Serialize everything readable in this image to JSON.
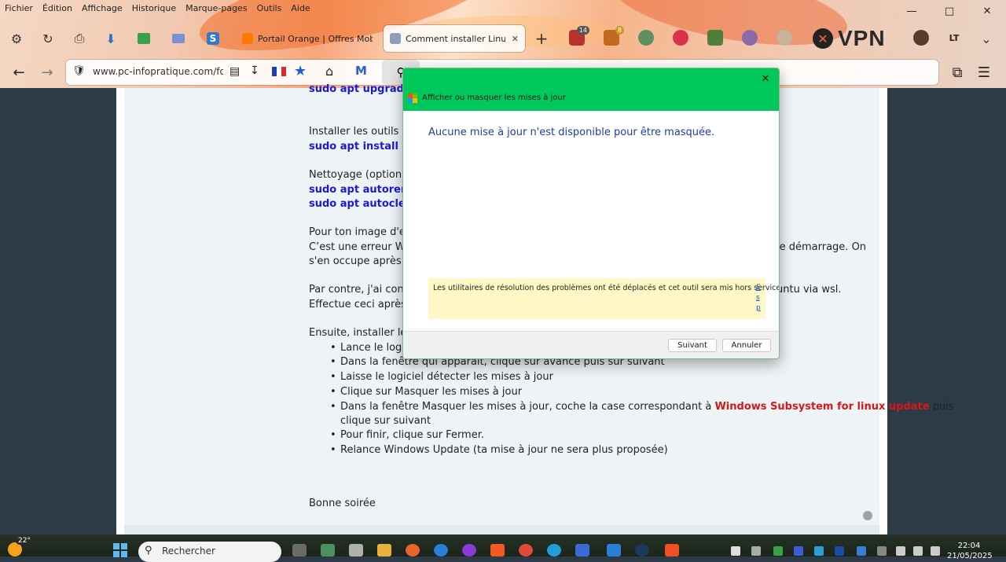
{
  "menubar": {
    "items": [
      "Fichier",
      "Édition",
      "Affichage",
      "Historique",
      "Marque-pages",
      "Outils",
      "Aide"
    ]
  },
  "tabs": [
    {
      "label": "Portail Orange | Offres Mobile",
      "active": false
    },
    {
      "label": "Comment installer Linux sur W",
      "active": true
    }
  ],
  "extensions": {
    "badge_1": "14",
    "badge_2": "8",
    "vpn_label": "VPN",
    "profile_label": "LT"
  },
  "address_bar": {
    "url": "www.pc-infopratique.com/forum"
  },
  "page": {
    "line_top_code": "sudo apt upgrade -y",
    "line_install": "Installer les outils de",
    "line_install_code": "sudo apt install -y b",
    "line_cleanup": "Nettoyage (optionne",
    "line_cleanup_code1": "sudo apt autoremov",
    "line_cleanup_code2": "sudo apt autoclean",
    "line_error1": "Pour ton image d'err",
    "line_error2": "C’est une erreur Wir",
    "line_error2_right": "le démarrage. On",
    "line_error3": "s'en occupe après.",
    "line_contra1": "Par contre, j'ai const",
    "line_contra1_right": "untu via wsl.",
    "line_contra2": "Effectue ceci après",
    "line_then": "Ensuite, installer le",
    "bullets": [
      "Lance le logic",
      "Dans la fenêtre qui apparait, clique sur avancé puis sur suivant",
      "Laisse le logiciel détecter les mises à jour",
      "Clique sur Masquer les mises à jour"
    ],
    "bullet5_start": "Dans la fenêtre Masquer les mises à jour, coche la case correspondant à",
    "bullet5_red": "Windows Subsystem for linux update",
    "bullet5_end": "puis",
    "bullet5_line2": "clique sur suivant",
    "bullet6": "Pour finir, clique sur Fermer.",
    "bullet7": "Relance Windows Update (ta mise à jour ne sera plus proposée)",
    "signoff": "Bonne soirée"
  },
  "dialog": {
    "title": "Afficher ou masquer les mises à jour",
    "message": "Aucune mise à jour n'est disponible pour être masquée.",
    "notice": "Les utilitaires de résolution des problèmes ont été déplacés et cet outil sera mis hors service.",
    "notice_link": "E s p",
    "next_label": "Suivant",
    "cancel_label": "Annuler"
  },
  "taskbar": {
    "temperature": "22°",
    "search_placeholder": "Rechercher",
    "time": "22:04",
    "date": "21/05/2025"
  },
  "colors": {
    "dialog_header": "#00c85a",
    "page_code": "#1a1ad6",
    "page_highlight": "#d81818",
    "dialog_message": "#1f3f99",
    "notice_bg": "#fff8c6"
  }
}
